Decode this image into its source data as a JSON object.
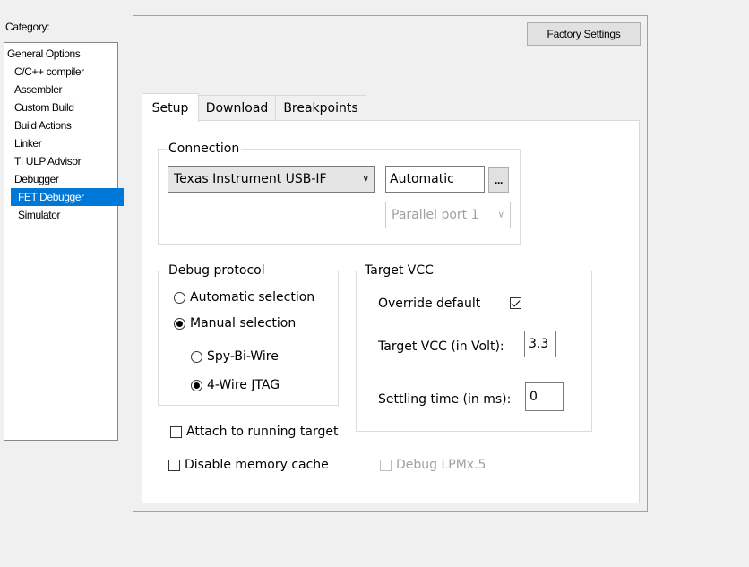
{
  "category": {
    "label": "Category:",
    "items": [
      {
        "label": "General Options",
        "level": 0,
        "selected": false
      },
      {
        "label": "C/C++ compiler",
        "level": 1,
        "selected": false
      },
      {
        "label": "Assembler",
        "level": 1,
        "selected": false
      },
      {
        "label": "Custom Build",
        "level": 1,
        "selected": false
      },
      {
        "label": "Build Actions",
        "level": 1,
        "selected": false
      },
      {
        "label": "Linker",
        "level": 1,
        "selected": false
      },
      {
        "label": "TI ULP Advisor",
        "level": 1,
        "selected": false
      },
      {
        "label": "Debugger",
        "level": 1,
        "selected": false
      },
      {
        "label": "FET Debugger",
        "level": 2,
        "selected": true
      },
      {
        "label": "Simulator",
        "level": 2,
        "selected": false
      }
    ]
  },
  "toolbar": {
    "factory_settings_label": "Factory Settings"
  },
  "tabs": [
    {
      "label": "Setup",
      "active": true
    },
    {
      "label": "Download",
      "active": false
    },
    {
      "label": "Breakpoints",
      "active": false
    }
  ],
  "connection": {
    "title": "Connection",
    "interface_value": "Texas Instrument USB-IF",
    "port_value": "Automatic",
    "browse_label": "...",
    "parallel_value": "Parallel port 1"
  },
  "debug_protocol": {
    "title": "Debug protocol",
    "automatic_label": "Automatic selection",
    "manual_label": "Manual selection",
    "spy_label": "Spy-Bi-Wire",
    "jtag_label": "4-Wire JTAG",
    "selected_mode": "manual",
    "selected_wire": "jtag"
  },
  "target_vcc": {
    "title": "Target VCC",
    "override_label": "Override default",
    "override_checked": true,
    "vcc_label": "Target VCC (in Volt):",
    "vcc_value": "3.3",
    "settling_label": "Settling time (in ms):",
    "settling_value": "0"
  },
  "options": {
    "attach_label": "Attach to running target",
    "disable_cache_label": "Disable memory cache",
    "lpm_label": "Debug LPMx.5"
  }
}
